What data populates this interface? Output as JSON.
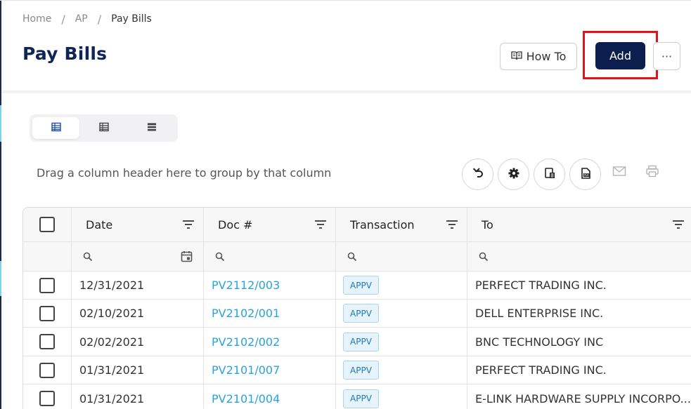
{
  "breadcrumb": {
    "items": [
      "Home",
      "AP",
      "Pay Bills"
    ],
    "separator": "/"
  },
  "page": {
    "title": "Pay Bills"
  },
  "actions": {
    "how_to": "How To",
    "add": "Add",
    "more": "···"
  },
  "grid_toolbar": {
    "group_hint": "Drag a column header here to group by that column",
    "icons": [
      "undo-icon",
      "settings-icon",
      "export-excel-icon",
      "export-pdf-icon",
      "email-icon",
      "print-icon"
    ]
  },
  "view_modes": [
    "table-large-icon",
    "table-medium-icon",
    "table-compact-icon"
  ],
  "table": {
    "columns": [
      "Date",
      "Doc #",
      "Transaction",
      "To"
    ],
    "rows": [
      {
        "date": "12/31/2021",
        "doc": "PV2112/003",
        "status": "APPV",
        "to": "PERFECT TRADING INC."
      },
      {
        "date": "02/10/2021",
        "doc": "PV2102/001",
        "status": "APPV",
        "to": "DELL ENTERPRISE INC."
      },
      {
        "date": "02/02/2021",
        "doc": "PV2102/002",
        "status": "APPV",
        "to": "BNC TECHNOLOGY INC"
      },
      {
        "date": "01/31/2021",
        "doc": "PV2101/007",
        "status": "APPV",
        "to": "PERFECT TRADING INC."
      },
      {
        "date": "01/31/2021",
        "doc": "PV2101/004",
        "status": "APPV",
        "to": "E-LINK HARDWARE SUPPLY INCORPO..."
      }
    ]
  },
  "colors": {
    "title": "#0f2557",
    "primary_button": "#0c1e4d",
    "highlight_box": "#e0141b",
    "link": "#2aa3d8",
    "badge_bg": "#e6f3fb",
    "badge_text": "#1f79b3"
  }
}
